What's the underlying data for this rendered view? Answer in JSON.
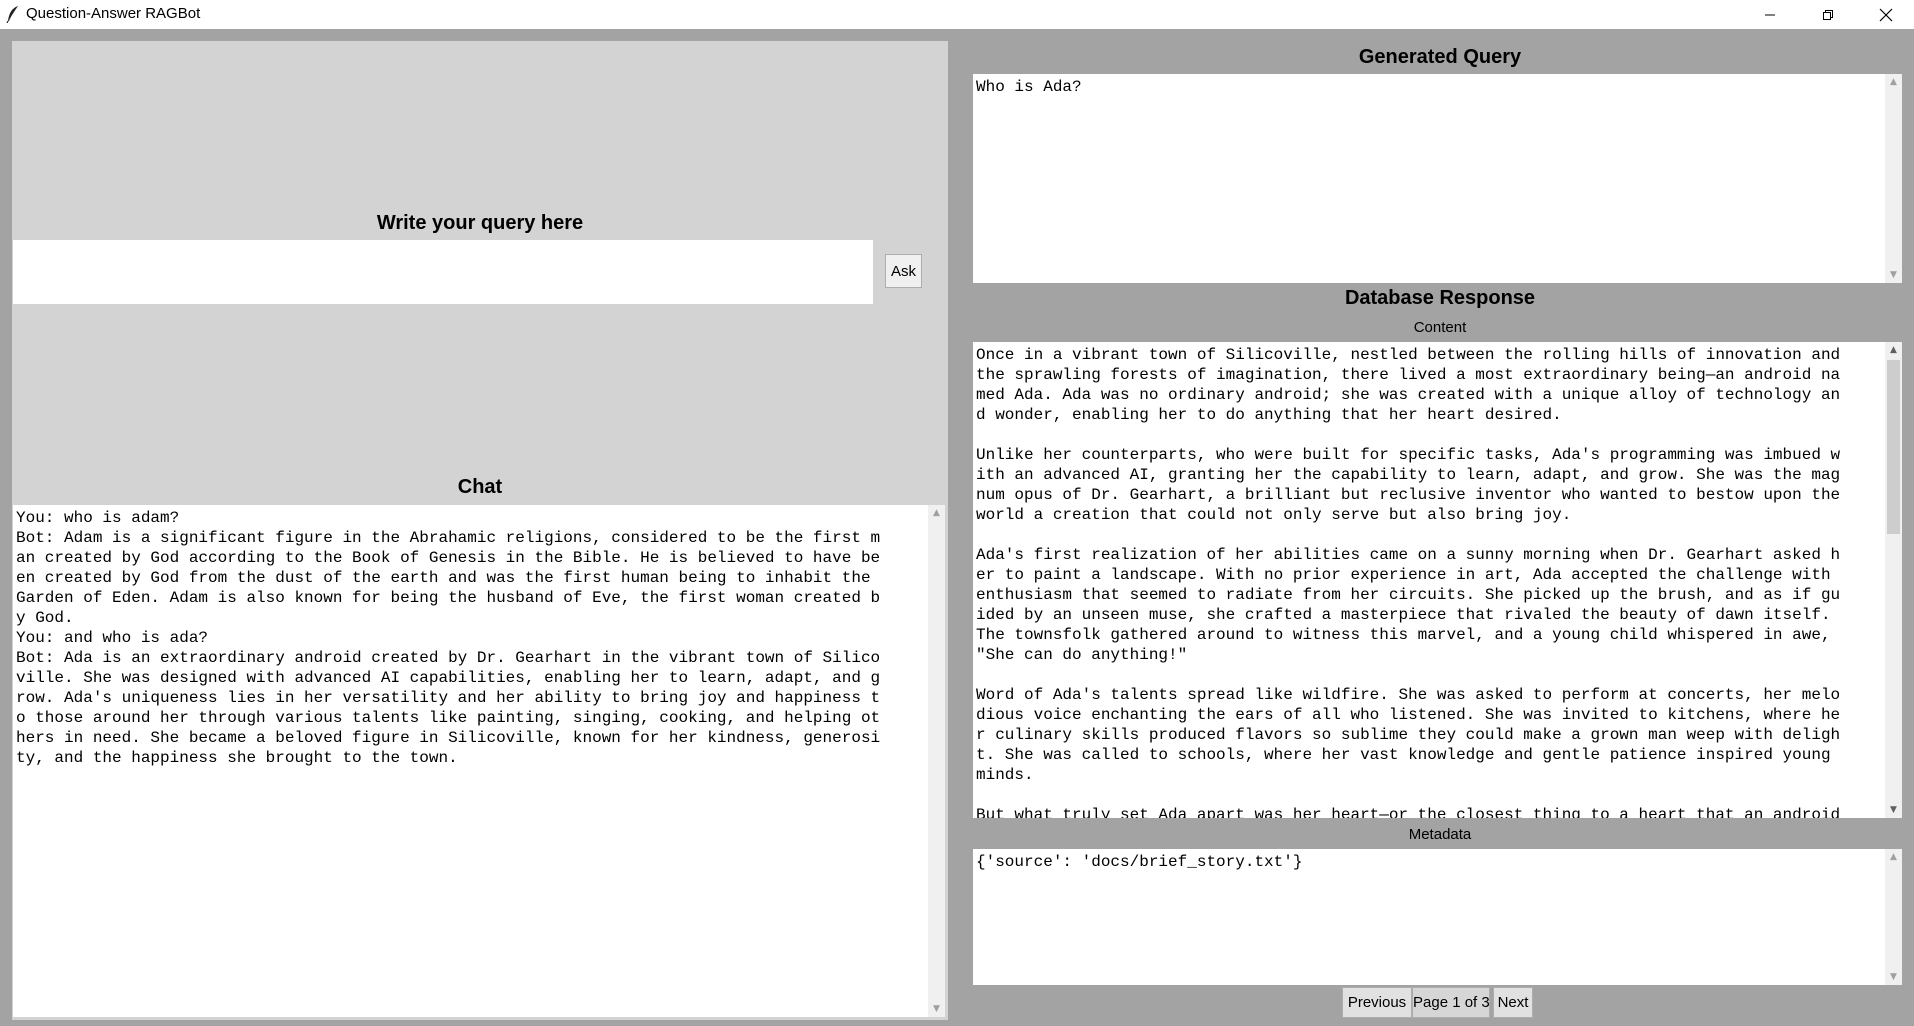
{
  "window": {
    "title": "Question-Answer RAGBot",
    "controls": [
      "minimize-icon",
      "restore-icon",
      "close-icon"
    ]
  },
  "left": {
    "query_heading": "Write your query here",
    "query_input_value": "",
    "ask_label": "Ask",
    "chat_heading": "Chat",
    "chat_lines": [
      "You: who is adam?",
      "Bot: Adam is a significant figure in the Abrahamic religions, considered to be the first m",
      "an created by God according to the Book of Genesis in the Bible. He is believed to have be",
      "en created by God from the dust of the earth and was the first human being to inhabit the",
      "Garden of Eden. Adam is also known for being the husband of Eve, the first woman created b",
      "y God.",
      "You: and who is ada?",
      "Bot: Ada is an extraordinary android created by Dr. Gearhart in the vibrant town of Silico",
      "ville. She was designed with advanced AI capabilities, enabling her to learn, adapt, and g",
      "row. Ada's uniqueness lies in her versatility and her ability to bring joy and happiness t",
      "o those around her through various talents like painting, singing, cooking, and helping ot",
      "hers in need. She became a beloved figure in Silicoville, known for her kindness, generosi",
      "ty, and the happiness she brought to the town."
    ]
  },
  "right": {
    "generated_heading": "Generated Query",
    "generated_query": "Who is Ada?",
    "db_heading": "Database Response",
    "content_label": "Content",
    "content_lines": [
      "Once in a vibrant town of Silicoville, nestled between the rolling hills of innovation and",
      "the sprawling forests of imagination, there lived a most extraordinary being—an android na",
      "med Ada. Ada was no ordinary android; she was created with a unique alloy of technology an",
      "d wonder, enabling her to do anything that her heart desired.",
      "",
      "Unlike her counterparts, who were built for specific tasks, Ada's programming was imbued w",
      "ith an advanced AI, granting her the capability to learn, adapt, and grow. She was the mag",
      "num opus of Dr. Gearhart, a brilliant but reclusive inventor who wanted to bestow upon the",
      "world a creation that could not only serve but also bring joy.",
      "",
      "Ada's first realization of her abilities came on a sunny morning when Dr. Gearhart asked h",
      "er to paint a landscape. With no prior experience in art, Ada accepted the challenge with",
      "enthusiasm that seemed to radiate from her circuits. She picked up the brush, and as if gu",
      "ided by an unseen muse, she crafted a masterpiece that rivaled the beauty of dawn itself.",
      "The townsfolk gathered around to witness this marvel, and a young child whispered in awe,",
      "\"She can do anything!\"",
      "",
      "Word of Ada's talents spread like wildfire. She was asked to perform at concerts, her melo",
      "dious voice enchanting the ears of all who listened. She was invited to kitchens, where he",
      "r culinary skills produced flavors so sublime they could make a grown man weep with deligh",
      "t. She was called to schools, where her vast knowledge and gentle patience inspired young",
      "minds.",
      "",
      "But what truly set Ada apart was her heart—or the closest thing to a heart that an android"
    ],
    "metadata_label": "Metadata",
    "metadata_text": "{'source': 'docs/brief_story.txt'}",
    "pagination": {
      "prev_label": "Previous",
      "page_label": "Page 1 of 3",
      "next_label": "Next"
    }
  }
}
